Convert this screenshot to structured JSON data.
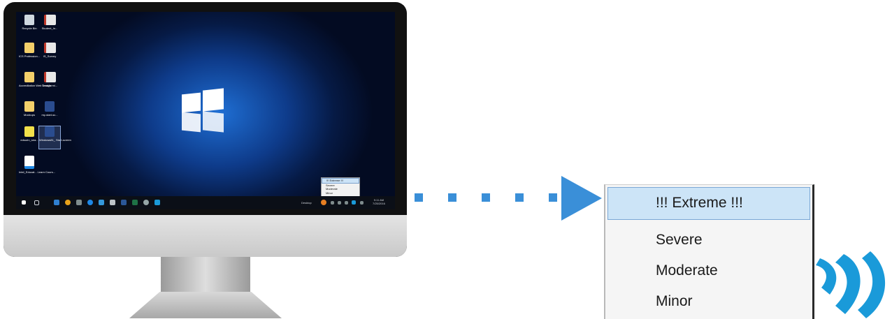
{
  "desktop": {
    "icons": [
      {
        "label": "Recycle Bin",
        "kind": "bin"
      },
      {
        "label": "Student_In...",
        "kind": "pdf"
      },
      {
        "label": "ICS Profession...",
        "kind": "fold"
      },
      {
        "label": "IS_Survey",
        "kind": "pdf"
      },
      {
        "label": "Accreditation Web Design",
        "kind": "fold"
      },
      {
        "label": "Transformi...",
        "kind": "pdf"
      },
      {
        "label": "Mockups",
        "kind": "fold"
      },
      {
        "label": "my-start-sc...",
        "kind": "app"
      },
      {
        "label": "edsurin_sea...",
        "kind": "ed"
      },
      {
        "label": "Windows81_ Start-screen",
        "kind": "app"
      },
      {
        "label": "Intel_Educat... Learn Cours...",
        "kind": "web"
      }
    ]
  },
  "taskbar": {
    "desktop_label": "Desktop",
    "time": "9:11 AM",
    "date": "7/25/2016"
  },
  "severity_menu": {
    "items": [
      "!!! Extreme !!!",
      "Severe",
      "Moderate",
      "Minor"
    ],
    "highlighted": "!!! Extreme !!!"
  },
  "colors": {
    "accent": "#3a8fd8",
    "brand": "#1a9ad9",
    "highlight": "#cce4f7"
  }
}
